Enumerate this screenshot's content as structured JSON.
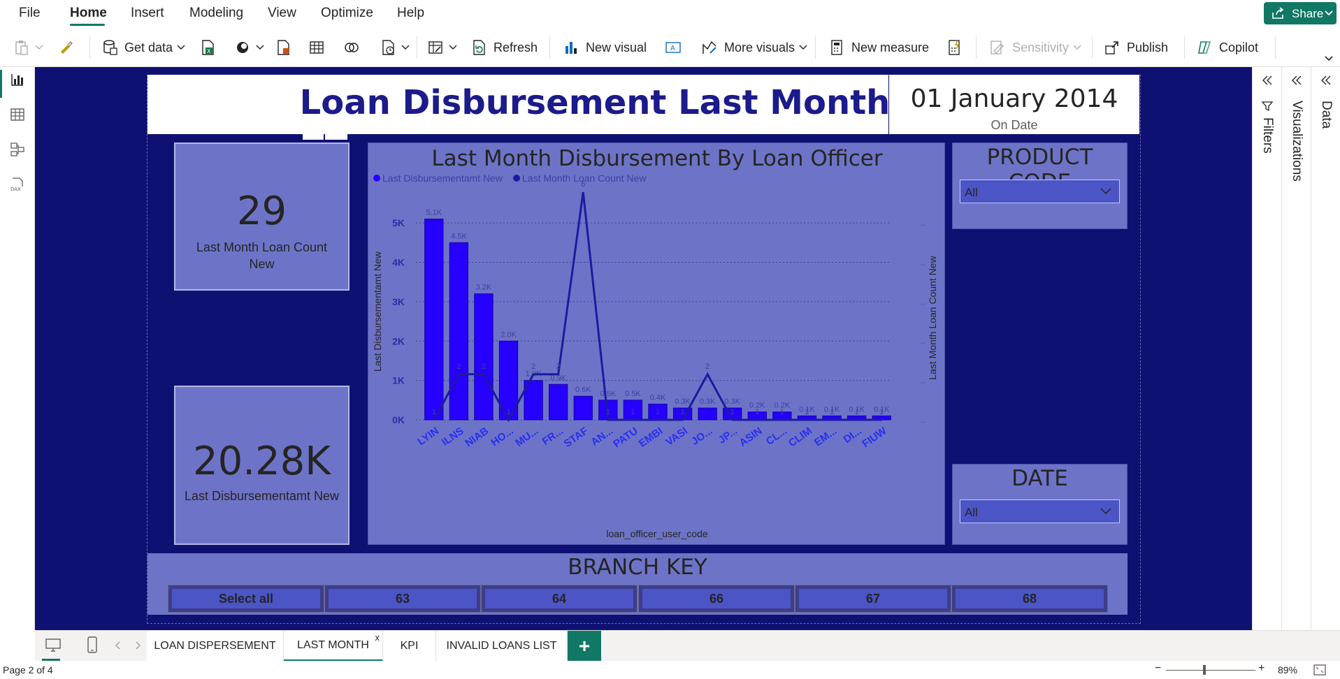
{
  "menu": {
    "items": [
      "File",
      "Home",
      "Insert",
      "Modeling",
      "View",
      "Optimize",
      "Help"
    ],
    "active": "Home",
    "share_label": "Share"
  },
  "ribbon": {
    "get_data": "Get data",
    "refresh": "Refresh",
    "new_visual": "New visual",
    "more_visuals": "More visuals",
    "new_measure": "New measure",
    "sensitivity": "Sensitivity",
    "publish": "Publish",
    "copilot": "Copilot"
  },
  "report": {
    "title": "Loan Disbursement Last Month",
    "date_value": "01 January 2014",
    "date_label": "On Date",
    "kpi_count_value": "29",
    "kpi_count_label": "Last Month Loan Count New",
    "kpi_amount_value": "20.28K",
    "kpi_amount_label": "Last  Disbursementamt New",
    "product_code_title": "PRODUCT CODE",
    "product_code_value": "All",
    "date_slicer_title": "DATE",
    "date_slicer_value": "All",
    "branch_title": "BRANCH KEY",
    "branch_options": [
      "Select all",
      "63",
      "64",
      "66",
      "67",
      "68"
    ]
  },
  "chart_data": {
    "type": "bar",
    "title": "Last Month Disbursement By Loan Officer",
    "xlabel": "loan_officer_user_code",
    "ylabel": "Last Disbursementamt New",
    "y2label": "Last Month Loan Count New",
    "categories": [
      "LYIN",
      "ILNS",
      "NIAB",
      "HO...",
      "MU...",
      "FR...",
      "STAF",
      "AN...",
      "PATU",
      "EMBI",
      "VASI",
      "JO...",
      "JP...",
      "ASIN",
      "CL...",
      "CLIM",
      "EM...",
      "DI...",
      "FIUW"
    ],
    "series": [
      {
        "name": "Last  Disbursementamt New",
        "type": "bar",
        "values": [
          5100,
          4500,
          3200,
          2000,
          1000,
          900,
          600,
          500,
          500,
          400,
          300,
          300,
          300,
          200,
          200,
          100,
          100,
          100,
          100
        ],
        "labels": [
          "5.1K",
          "4.5K",
          "3.2K",
          "2.0K",
          "1.0K",
          "0.9K",
          "0.6K",
          "0.5K",
          "0.5K",
          "0.4K",
          "0.3K",
          "0.3K",
          "0.3K",
          "0.2K",
          "0.2K",
          "0.1K",
          "0.1K",
          "0.1K",
          "0.1K"
        ]
      },
      {
        "name": "Last Month Loan Count  New",
        "type": "line",
        "values": [
          1,
          2,
          2,
          1,
          2,
          2,
          6,
          1,
          1,
          1,
          1,
          2,
          1,
          1,
          1,
          1,
          1,
          1,
          1
        ]
      }
    ],
    "yticks": [
      "0K",
      "1K",
      "2K",
      "3K",
      "4K",
      "5K"
    ],
    "ylim": [
      0,
      5500
    ],
    "y2lim": [
      1,
      6
    ],
    "legend": "top-left",
    "grid": true,
    "colors": {
      "bar": "#2600ff",
      "line": "#1b1ba0"
    }
  },
  "tabs": [
    "LOAN DISPERSEMENT",
    "LAST MONTH",
    "KPI",
    "INVALID LOANS LIST"
  ],
  "active_tab": "LAST MONTH",
  "tab_close": "x",
  "tab_add": "+",
  "panes": {
    "filters": "Filters",
    "visualizations": "Visualizations",
    "data": "Data"
  },
  "status": {
    "page": "Page 2 of 4",
    "zoom": "89%"
  }
}
